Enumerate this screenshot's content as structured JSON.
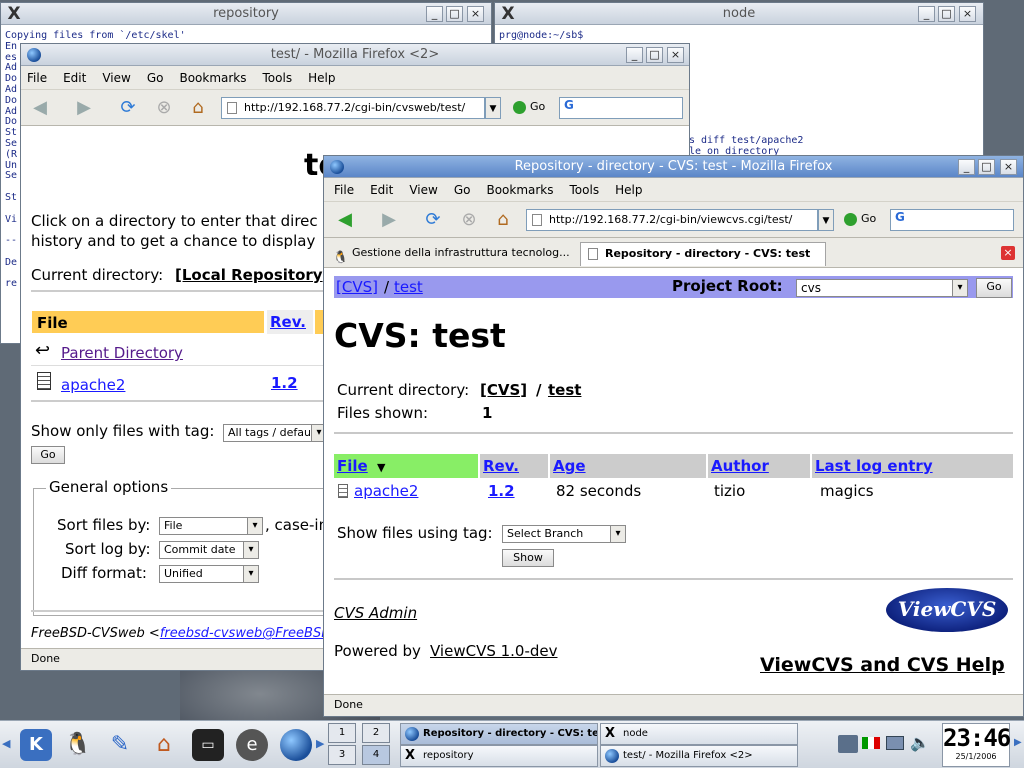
{
  "repository_window": {
    "title": "repository",
    "lines": [
      "Copying files from `/etc/skel'",
      "En",
      "es",
      "Ad",
      "Do",
      "Ad",
      "Do",
      "Ad",
      "Do",
      "St",
      "Se",
      "(R",
      "Un",
      "Se",
      "",
      "St",
      "",
      "Vi",
      "",
      "--",
      "",
      "De",
      "",
      "re"
    ]
  },
  "node_window": {
    "title": "node",
    "prompt": "prg@node:~/sb$",
    "lines": [
      "s diff test/apache2",
      "le on directory"
    ]
  },
  "cvsweb_window": {
    "title": "test/ - Mozilla Firefox <2>",
    "menu": [
      "File",
      "Edit",
      "View",
      "Go",
      "Bookmarks",
      "Tools",
      "Help"
    ],
    "url": "http://192.168.77.2/cgi-bin/cvsweb/test/",
    "go_label": "Go",
    "heading_fragment": "te",
    "intro_line1": "Click on a directory to enter that direc",
    "intro_line2": "history and to get a chance to display",
    "current_dir_label": "Current directory:",
    "current_dir_link": "[Local Repository",
    "table_headers": [
      "File",
      "Rev."
    ],
    "rows": [
      {
        "name": "Parent Directory",
        "rev": ""
      },
      {
        "name": "apache2",
        "rev": "1.2"
      }
    ],
    "tag_label": "Show only files with tag:",
    "tag_select": "All tags / default",
    "go_button": "Go",
    "general_options": "General options",
    "sort_files_label": "Sort files by:",
    "sort_files_value": "File",
    "case_text": ", case-in",
    "sort_log_label": "Sort log by:",
    "sort_log_value": "Commit date",
    "diff_label": "Diff format:",
    "diff_value": "Unified",
    "footer_text": "FreeBSD-CVSweb <",
    "footer_link": "freebsd-cvsweb@FreeBSD",
    "status": "Done"
  },
  "viewcvs_window": {
    "title": "Repository - directory - CVS: test - Mozilla Firefox",
    "menu": [
      "File",
      "Edit",
      "View",
      "Go",
      "Bookmarks",
      "Tools",
      "Help"
    ],
    "url": "http://192.168.77.2/cgi-bin/viewcvs.cgi/test/",
    "go_label": "Go",
    "tabs": [
      "Gestione della infrastruttura tecnolog...",
      "Repository - directory - CVS: test"
    ],
    "breadcrumb_root": "[CVS]",
    "breadcrumb_sep": "/",
    "breadcrumb_dir": "test",
    "project_root_label": "Project Root:",
    "project_root_value": "cvs",
    "project_go": "Go",
    "heading": "CVS: test",
    "current_dir_label": "Current directory:",
    "current_dir_root": "[CVS]",
    "current_dir_sep": "/",
    "current_dir_dir": "test",
    "files_shown_label": "Files shown:",
    "files_shown_value": "1",
    "columns": [
      "File",
      "Rev.",
      "Age",
      "Author",
      "Last log entry"
    ],
    "rows": [
      {
        "file": "apache2",
        "rev": "1.2",
        "age": "82 seconds",
        "author": "tizio",
        "log": "magics"
      }
    ],
    "tag_label": "Show files using tag:",
    "tag_select": "Select Branch",
    "show_button": "Show",
    "admin_link": "CVS Admin",
    "logo_text": "ViewCVS",
    "powered_label": "Powered by",
    "powered_link": "ViewCVS 1.0-dev",
    "help_link": "ViewCVS and CVS Help",
    "status": "Done"
  },
  "taskbar": {
    "pager": [
      "1",
      "2",
      "3",
      "4"
    ],
    "tasks": [
      {
        "label": "Repository - directory - CVS: test",
        "active": true
      },
      {
        "label": "node",
        "active": false
      },
      {
        "label": "repository",
        "active": false
      },
      {
        "label": "test/ - Mozilla Firefox <2>",
        "active": false
      }
    ],
    "clock_time": "23:46",
    "clock_date": "25/1/2006"
  },
  "colors": {
    "link": "#1a1aff",
    "cvsweb_header": "#ffcc55",
    "viewcvs_bar": "#9999ee",
    "viewcvs_file_col": "#88ee66",
    "viewcvs_header": "#cccccc"
  }
}
